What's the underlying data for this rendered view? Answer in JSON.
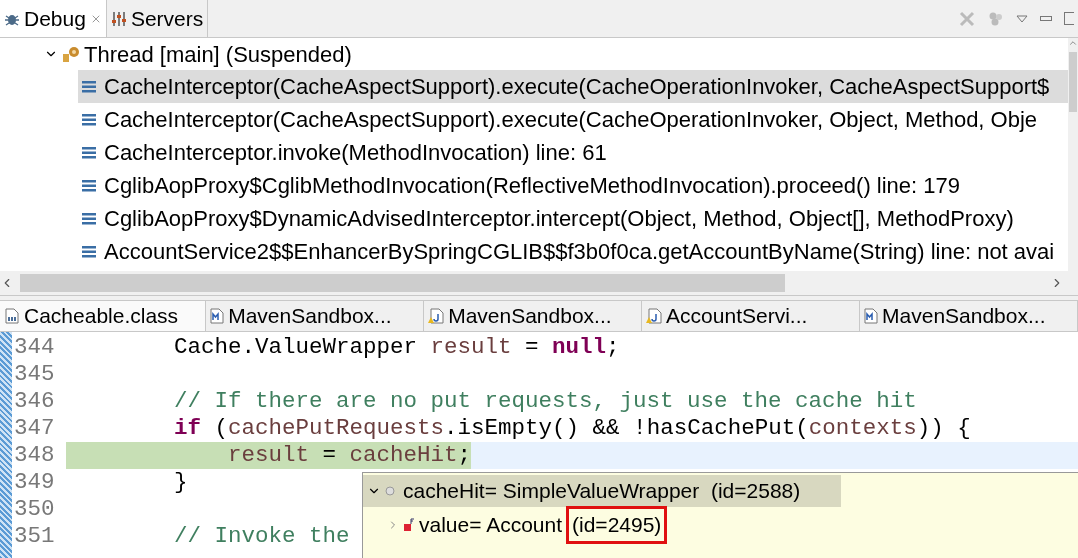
{
  "debug_view": {
    "tabs": [
      {
        "label": "Debug",
        "selected": true,
        "closable": true
      },
      {
        "label": "Servers",
        "selected": false,
        "closable": false
      }
    ],
    "thread": {
      "label": "Thread [main] (Suspended)",
      "expanded": true,
      "frames": [
        {
          "label": "CacheInterceptor(CacheAspectSupport).execute(CacheOperationInvoker, CacheAspectSupport$",
          "selected": true
        },
        {
          "label": "CacheInterceptor(CacheAspectSupport).execute(CacheOperationInvoker, Object, Method, Obje",
          "selected": false
        },
        {
          "label": "CacheInterceptor.invoke(MethodInvocation) line: 61",
          "selected": false
        },
        {
          "label": "CglibAopProxy$CglibMethodInvocation(ReflectiveMethodInvocation).proceed() line: 179",
          "selected": false
        },
        {
          "label": "CglibAopProxy$DynamicAdvisedInterceptor.intercept(Object, Method, Object[], MethodProxy)",
          "selected": false
        },
        {
          "label": "AccountService2$$EnhancerBySpringCGLIB$$f3b0f0ca.getAccountByName(String) line: not avai",
          "selected": false
        }
      ]
    }
  },
  "editor": {
    "tabs": [
      {
        "label": "Cacheable.class",
        "kind": "class",
        "selected": true
      },
      {
        "label": "MavenSandbox...",
        "kind": "maven",
        "selected": false
      },
      {
        "label": "MavenSandbox...",
        "kind": "java",
        "selected": false
      },
      {
        "label": "AccountServi...",
        "kind": "java",
        "selected": false
      },
      {
        "label": "MavenSandbox...",
        "kind": "maven",
        "selected": false
      }
    ],
    "lines": [
      {
        "number": "344",
        "current": false,
        "tokens": [
          {
            "kind": "plain",
            "text": "        Cache.ValueWrapper "
          },
          {
            "kind": "var",
            "text": "result"
          },
          {
            "kind": "plain",
            "text": " = "
          },
          {
            "kind": "keyword",
            "text": "null"
          },
          {
            "kind": "plain",
            "text": ";"
          }
        ]
      },
      {
        "number": "345",
        "current": false
      },
      {
        "number": "346",
        "current": false,
        "tokens": [
          {
            "kind": "comment",
            "text": "        // If there are no put requests, just use the cache hit"
          }
        ]
      },
      {
        "number": "347",
        "current": false,
        "tokens": [
          {
            "kind": "keyword",
            "text": "        if"
          },
          {
            "kind": "plain",
            "text": " ("
          },
          {
            "kind": "var",
            "text": "cachePutRequests"
          },
          {
            "kind": "plain",
            "text": ".isEmpty() && !hasCachePut("
          },
          {
            "kind": "var",
            "text": "contexts"
          },
          {
            "kind": "plain",
            "text": ")) {"
          }
        ]
      },
      {
        "number": "348",
        "current": true,
        "tokens": [
          {
            "kind": "var",
            "text": "            result"
          },
          {
            "kind": "plain",
            "text": " = "
          },
          {
            "kind": "var",
            "text": "cacheHit"
          },
          {
            "kind": "plain",
            "text": ";"
          }
        ]
      },
      {
        "number": "349",
        "current": false,
        "tokens": [
          {
            "kind": "plain",
            "text": "        }"
          }
        ]
      },
      {
        "number": "350",
        "current": false
      },
      {
        "number": "351",
        "current": false,
        "tokens": [
          {
            "kind": "comment",
            "text": "        // Invoke the"
          }
        ]
      }
    ],
    "hover": {
      "root": {
        "label": "cacheHit= SimpleValueWrapper  (id=2588)",
        "expanded": true,
        "selected": true
      },
      "child": {
        "label": "value= Account",
        "id": "(id=2495)",
        "expanded": false,
        "boxed": true
      }
    }
  }
}
